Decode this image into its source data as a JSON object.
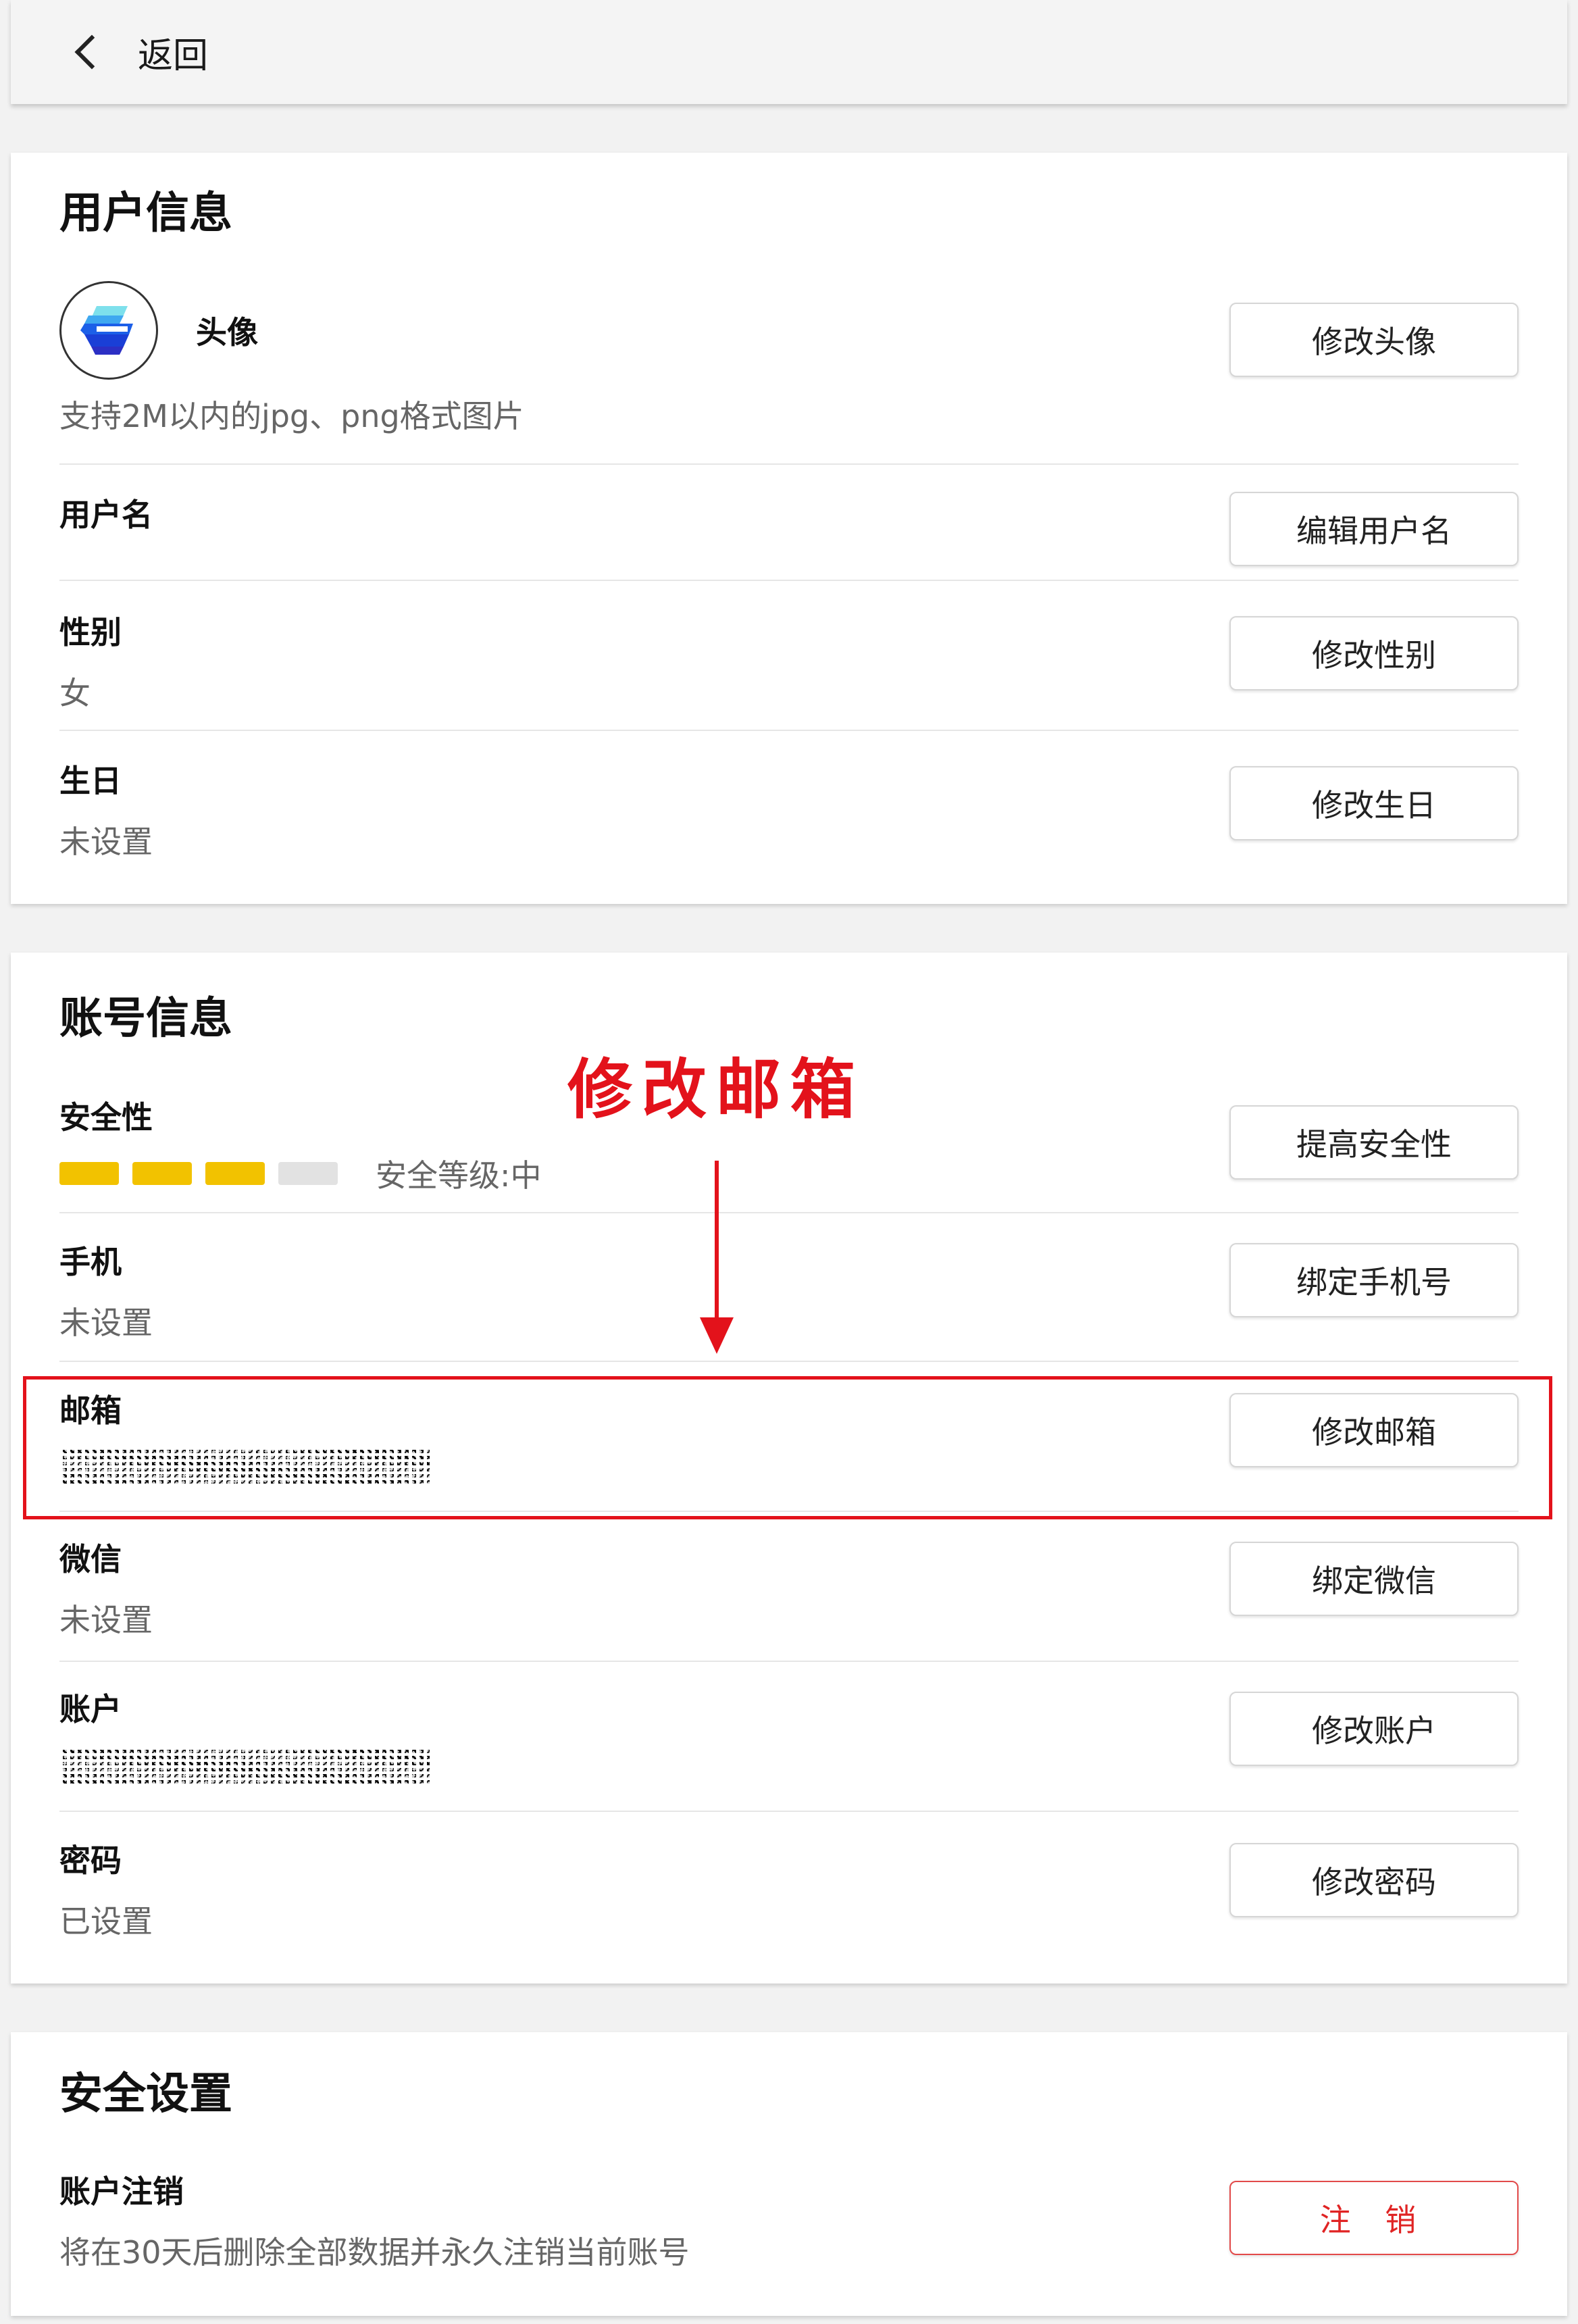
{
  "header": {
    "back_label": "返回"
  },
  "user_info": {
    "title": "用户信息",
    "avatar": {
      "label": "头像",
      "hint": "支持2M以内的jpg、png格式图片",
      "button": "修改头像"
    },
    "username": {
      "label": "用户名",
      "button": "编辑用户名"
    },
    "gender": {
      "label": "性别",
      "value": "女",
      "button": "修改性别"
    },
    "birthday": {
      "label": "生日",
      "value": "未设置",
      "button": "修改生日"
    }
  },
  "account_info": {
    "title": "账号信息",
    "security": {
      "label": "安全性",
      "level_text": "安全等级:中",
      "level": 3,
      "level_max": 4,
      "button": "提高安全性"
    },
    "phone": {
      "label": "手机",
      "value": "未设置",
      "button": "绑定手机号"
    },
    "email": {
      "label": "邮箱",
      "button": "修改邮箱"
    },
    "wechat": {
      "label": "微信",
      "value": "未设置",
      "button": "绑定微信"
    },
    "account": {
      "label": "账户",
      "button": "修改账户"
    },
    "password": {
      "label": "密码",
      "value": "已设置",
      "button": "修改密码"
    }
  },
  "security_settings": {
    "title": "安全设置",
    "deregister": {
      "label": "账户注销",
      "hint": "将在30天后删除全部数据并永久注销当前账号",
      "button": "注 销"
    }
  },
  "annotation": {
    "text": "修改邮箱"
  },
  "colors": {
    "accent_red": "#e3121b",
    "security_on": "#f2c200",
    "security_off": "#e2e2e2"
  }
}
